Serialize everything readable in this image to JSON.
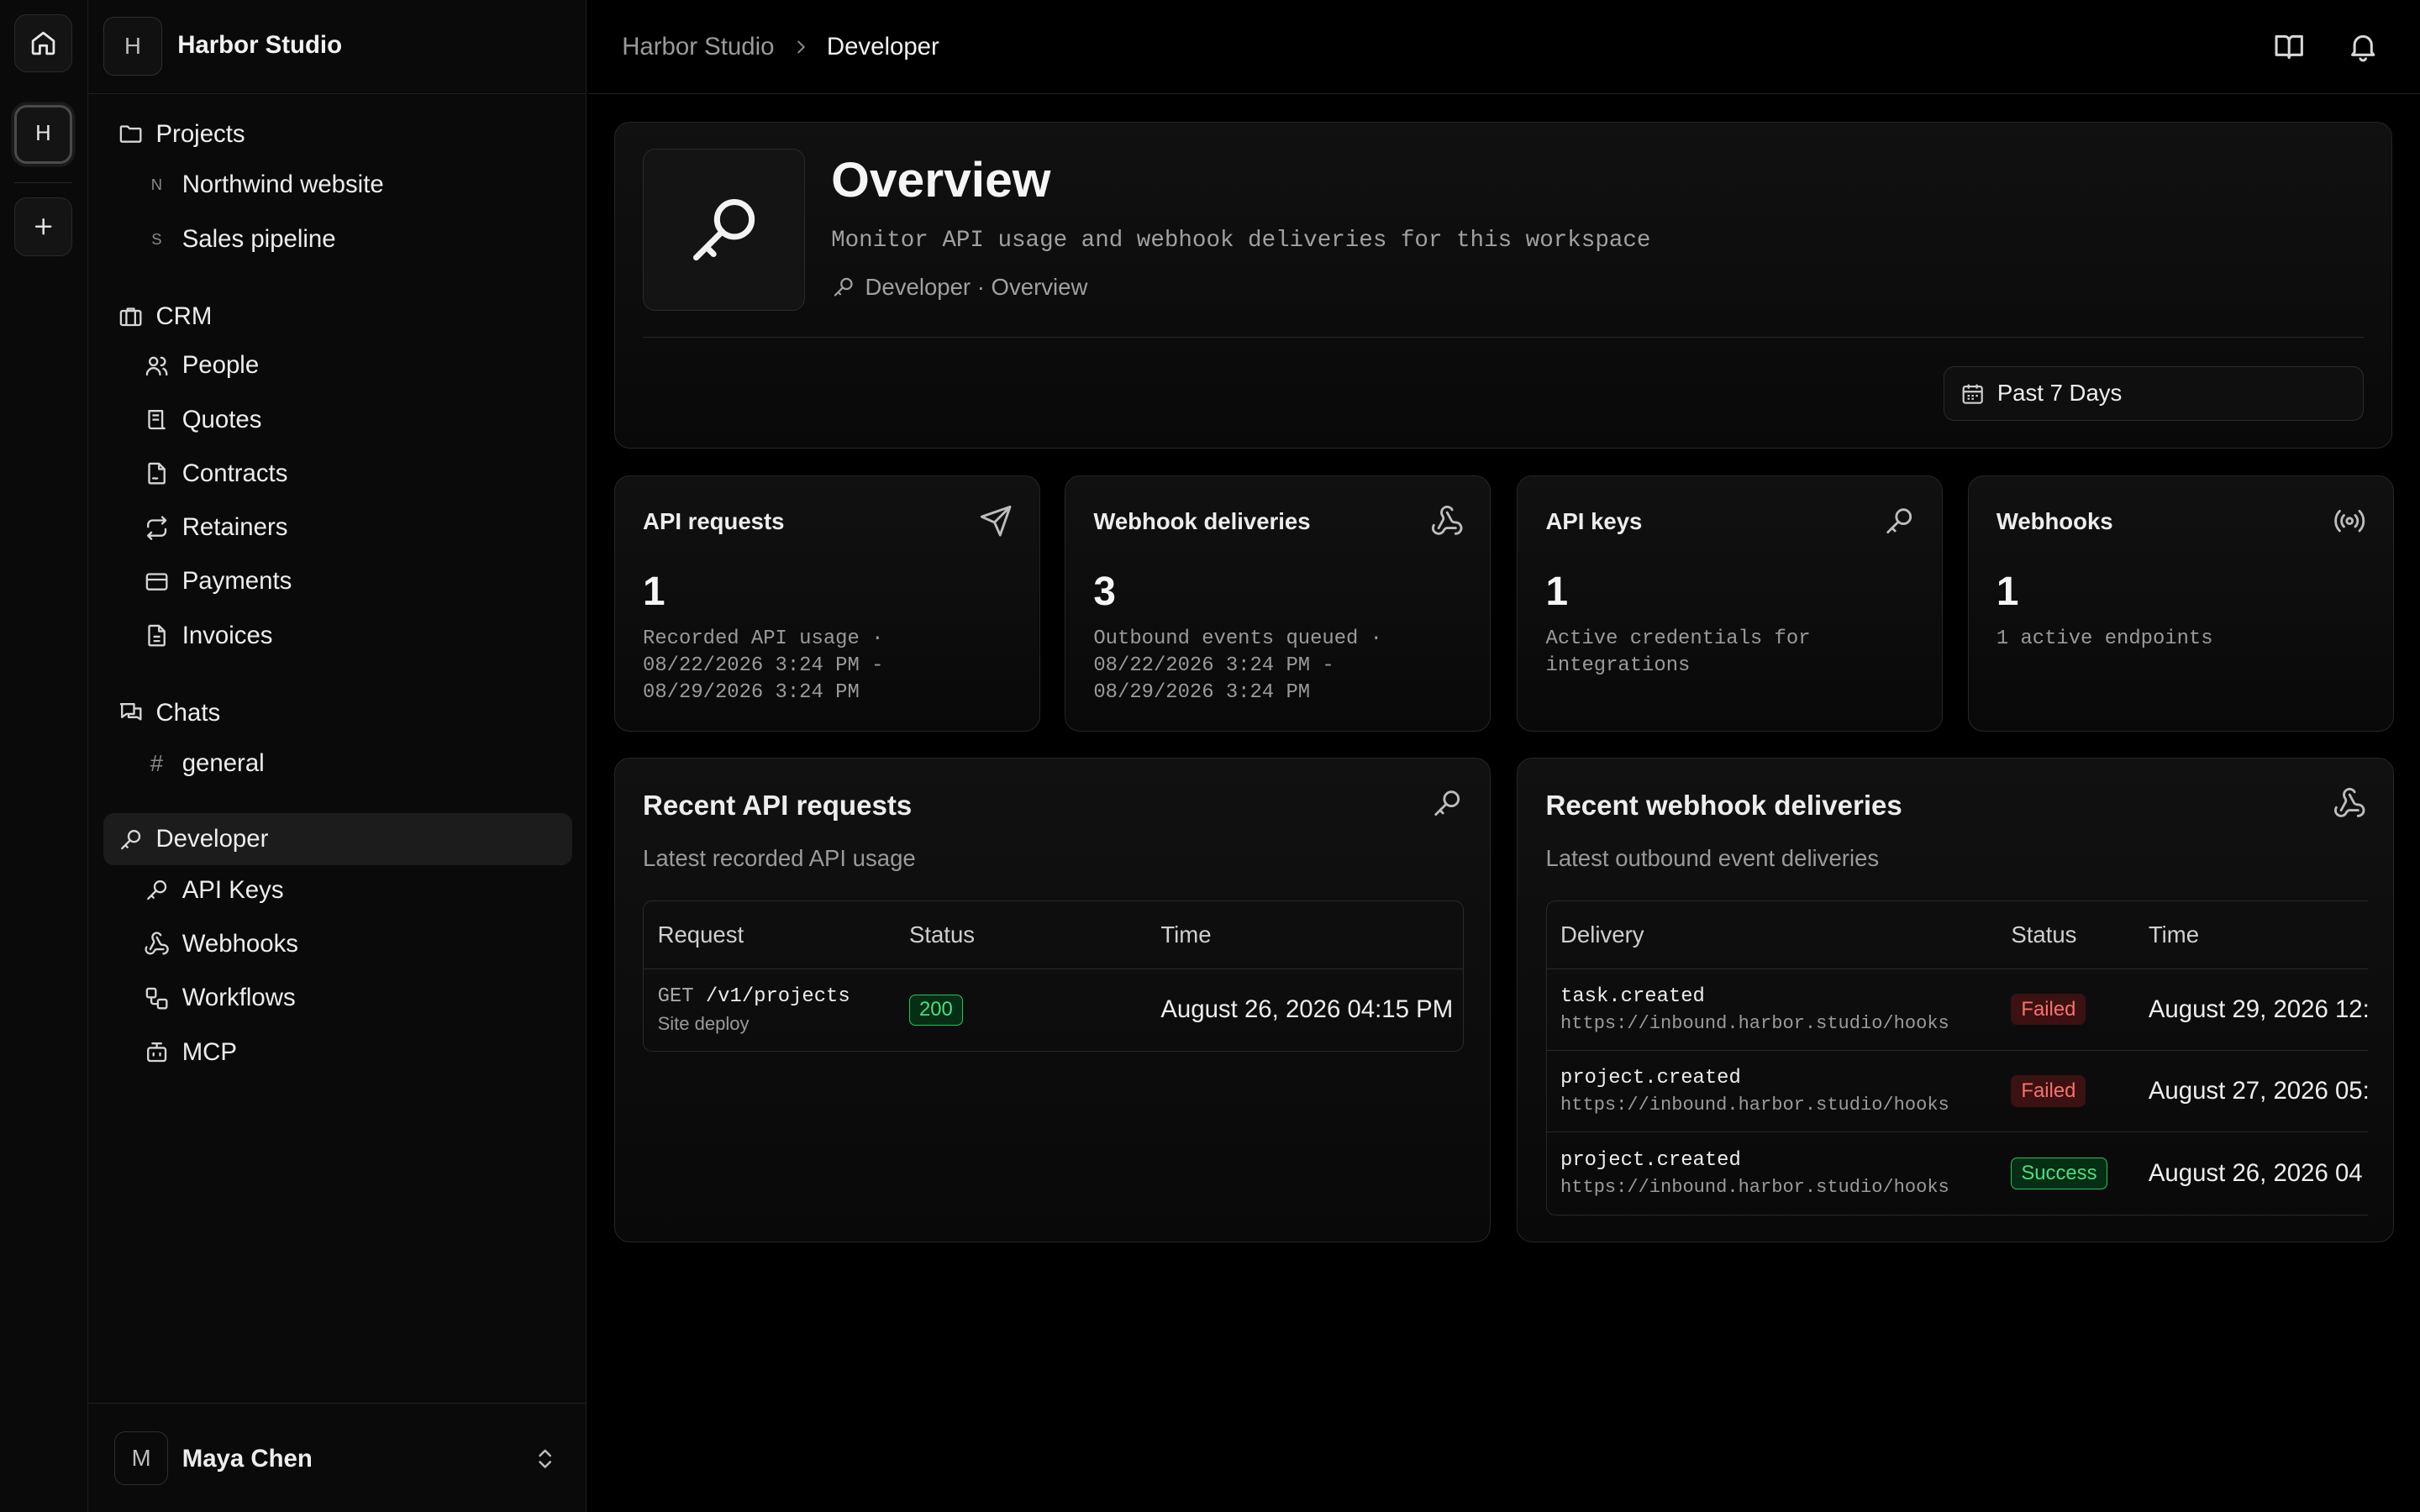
{
  "rail": {
    "workspace_letter": "H"
  },
  "workspace": {
    "letter": "H",
    "name": "Harbor Studio"
  },
  "sidebar": {
    "projects": {
      "label": "Projects",
      "items": [
        {
          "letter": "N",
          "label": "Northwind website"
        },
        {
          "letter": "S",
          "label": "Sales pipeline"
        }
      ]
    },
    "crm": {
      "label": "CRM",
      "items": [
        {
          "icon": "users-icon",
          "label": "People"
        },
        {
          "icon": "scroll-icon",
          "label": "Quotes"
        },
        {
          "icon": "file-signature-icon",
          "label": "Contracts"
        },
        {
          "icon": "repeat-icon",
          "label": "Retainers"
        },
        {
          "icon": "credit-card-icon",
          "label": "Payments"
        },
        {
          "icon": "file-text-icon",
          "label": "Invoices"
        }
      ]
    },
    "chats": {
      "label": "Chats",
      "items": [
        {
          "label": "general"
        }
      ]
    },
    "developer": {
      "label": "Developer",
      "items": [
        {
          "icon": "key-icon",
          "label": "API Keys"
        },
        {
          "icon": "webhook-icon",
          "label": "Webhooks"
        },
        {
          "icon": "workflow-icon",
          "label": "Workflows"
        },
        {
          "icon": "bot-icon",
          "label": "MCP"
        }
      ]
    }
  },
  "user": {
    "letter": "M",
    "name": "Maya Chen"
  },
  "breadcrumb": {
    "parent": "Harbor Studio",
    "current": "Developer"
  },
  "overview": {
    "title": "Overview",
    "subtitle": "Monitor API usage and webhook deliveries for this workspace",
    "path": "Developer · Overview",
    "date_range": "Past 7 Days"
  },
  "stats": [
    {
      "title": "API requests",
      "value": "1",
      "desc": "Recorded API usage · 08/22/2026 3:24 PM - 08/29/2026 3:24 PM",
      "icon": "send-icon"
    },
    {
      "title": "Webhook deliveries",
      "value": "3",
      "desc": "Outbound events queued · 08/22/2026 3:24 PM - 08/29/2026 3:24 PM",
      "icon": "webhook-icon"
    },
    {
      "title": "API keys",
      "value": "1",
      "desc": "Active credentials for integrations",
      "icon": "key-icon"
    },
    {
      "title": "Webhooks",
      "value": "1",
      "desc": "1 active endpoints",
      "icon": "radio-icon"
    }
  ],
  "api_requests": {
    "title": "Recent API requests",
    "subtitle": "Latest recorded API usage",
    "columns": [
      "Request",
      "Status",
      "Time"
    ],
    "rows": [
      {
        "method": "GET",
        "path": "/v1/projects",
        "source": "Site deploy",
        "status": "200",
        "time": "August 26, 2026 04:15 PM"
      }
    ]
  },
  "webhook_deliveries": {
    "title": "Recent webhook deliveries",
    "subtitle": "Latest outbound event deliveries",
    "columns": [
      "Delivery",
      "Status",
      "Time"
    ],
    "rows": [
      {
        "event": "task.created",
        "url": "https://inbound.harbor.studio/hooks",
        "status": "Failed",
        "time": "August 29, 2026 12:"
      },
      {
        "event": "project.created",
        "url": "https://inbound.harbor.studio/hooks",
        "status": "Failed",
        "time": "August 27, 2026 05:"
      },
      {
        "event": "project.created",
        "url": "https://inbound.harbor.studio/hooks",
        "status": "Success",
        "time": "August 26, 2026 04"
      }
    ]
  },
  "colors": {
    "background": "#000000",
    "panel": "#0d0d0d",
    "success": "#4ade80",
    "failed": "#f87171"
  }
}
